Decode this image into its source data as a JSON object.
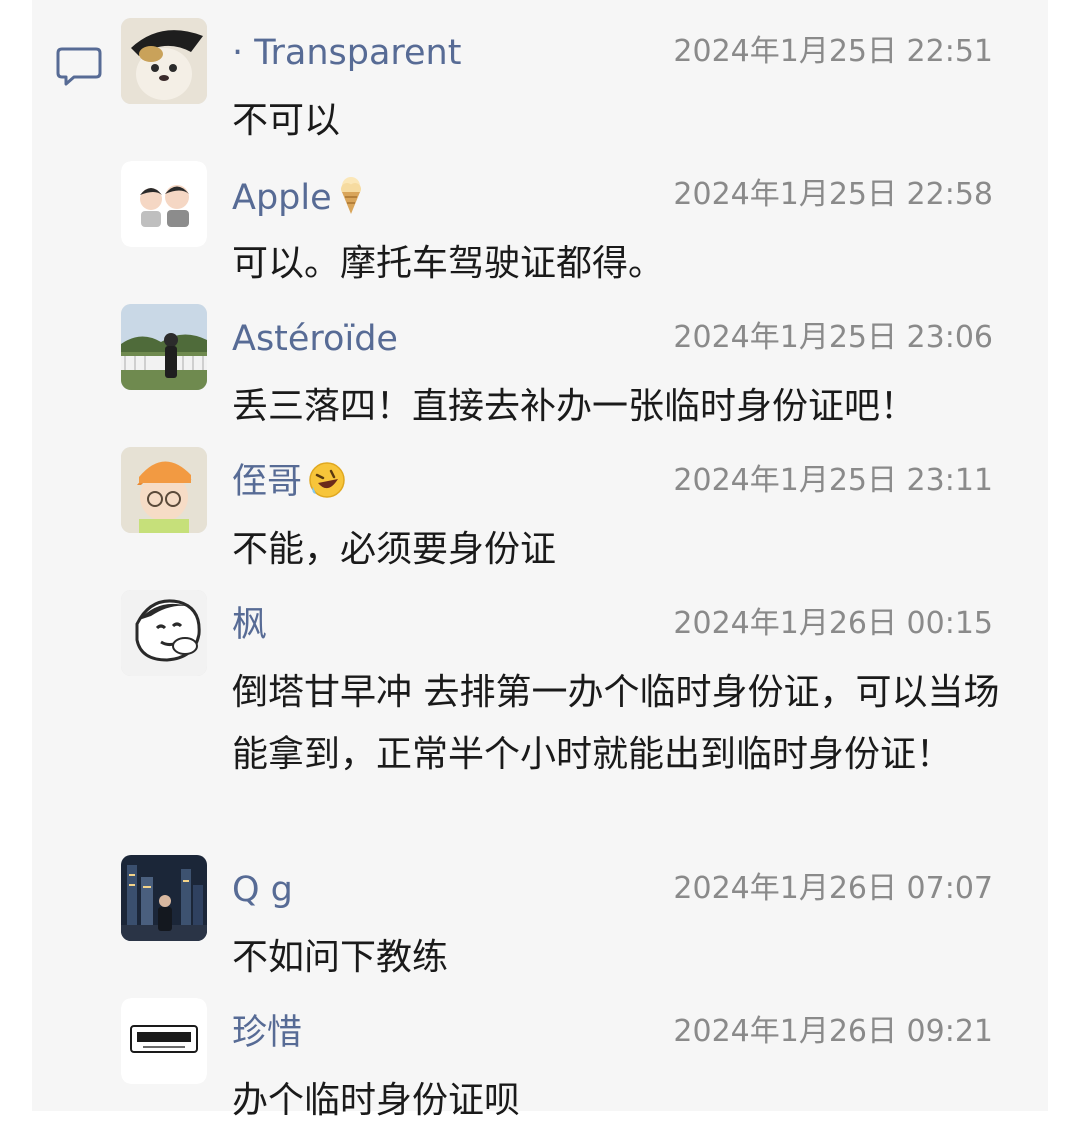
{
  "comments": [
    {
      "name": "· Transparent",
      "time": "2024年1月25日 22:51",
      "text": "不可以",
      "avatar": "puppy-with-hat"
    },
    {
      "name": "Apple",
      "name_emoji": "ice-cream-icon",
      "time": "2024年1月25日 22:58",
      "text": "可以。摩托车驾驶证都得。",
      "avatar": "cartoon-couple"
    },
    {
      "name": "Astéroïde",
      "time": "2024年1月25日 23:06",
      "text": "丢三落四！直接去补办一张临时身份证吧！",
      "avatar": "girl-outdoors-photo"
    },
    {
      "name": "侄哥",
      "name_emoji": "rolling-laughing-icon",
      "time": "2024年1月25日 23:11",
      "text": "不能，必须要身份证",
      "avatar": "kid-with-glasses"
    },
    {
      "name": "枫",
      "time": "2024年1月26日 00:15",
      "text": "倒塔甘早冲 去排第一办个临时身份证，可以当场能拿到，正常半个小时就能出到临时身份证！",
      "avatar": "sketch-cartoon"
    },
    {
      "name": "Q g",
      "time": "2024年1月26日 07:07",
      "text": "不如问下教练",
      "avatar": "city-night-photo"
    },
    {
      "name": "珍惜",
      "time": "2024年1月26日 09:21",
      "text": "办个临时身份证呗",
      "avatar": "logo-badge"
    }
  ]
}
